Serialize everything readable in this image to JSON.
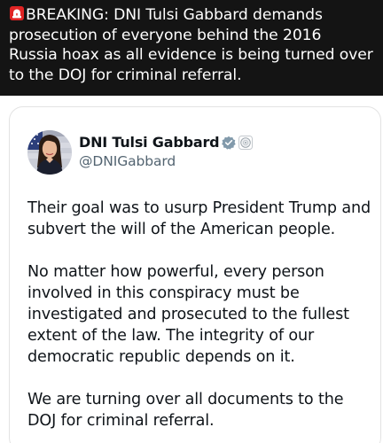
{
  "header": {
    "siren_icon": "rotating-light-siren-emoji",
    "headline": "BREAKING: DNI Tulsi Gabbard demands prosecution of everyone behind the 2016 Russia hoax as all evidence is being turned over to the DOJ for criminal referral."
  },
  "post": {
    "author": {
      "display_name": "DNI Tulsi Gabbard",
      "handle": "@DNIGabbard",
      "verified_badge_color": "#829aab",
      "affiliation_badge_icon": "government-seal-icon"
    },
    "paragraphs": [
      "Their goal was to usurp President Trump and subvert the will of the American people.",
      "No matter how powerful, every person involved in this conspiracy must be investigated and prosecuted to the fullest extent of the law. The integrity of our democratic republic depends on it.",
      "We are turning over all documents to the DOJ for criminal referral."
    ]
  },
  "colors": {
    "header_bg": "#141414",
    "header_text": "#ffffff",
    "name_text": "#0f1419",
    "handle_text": "#536471"
  }
}
